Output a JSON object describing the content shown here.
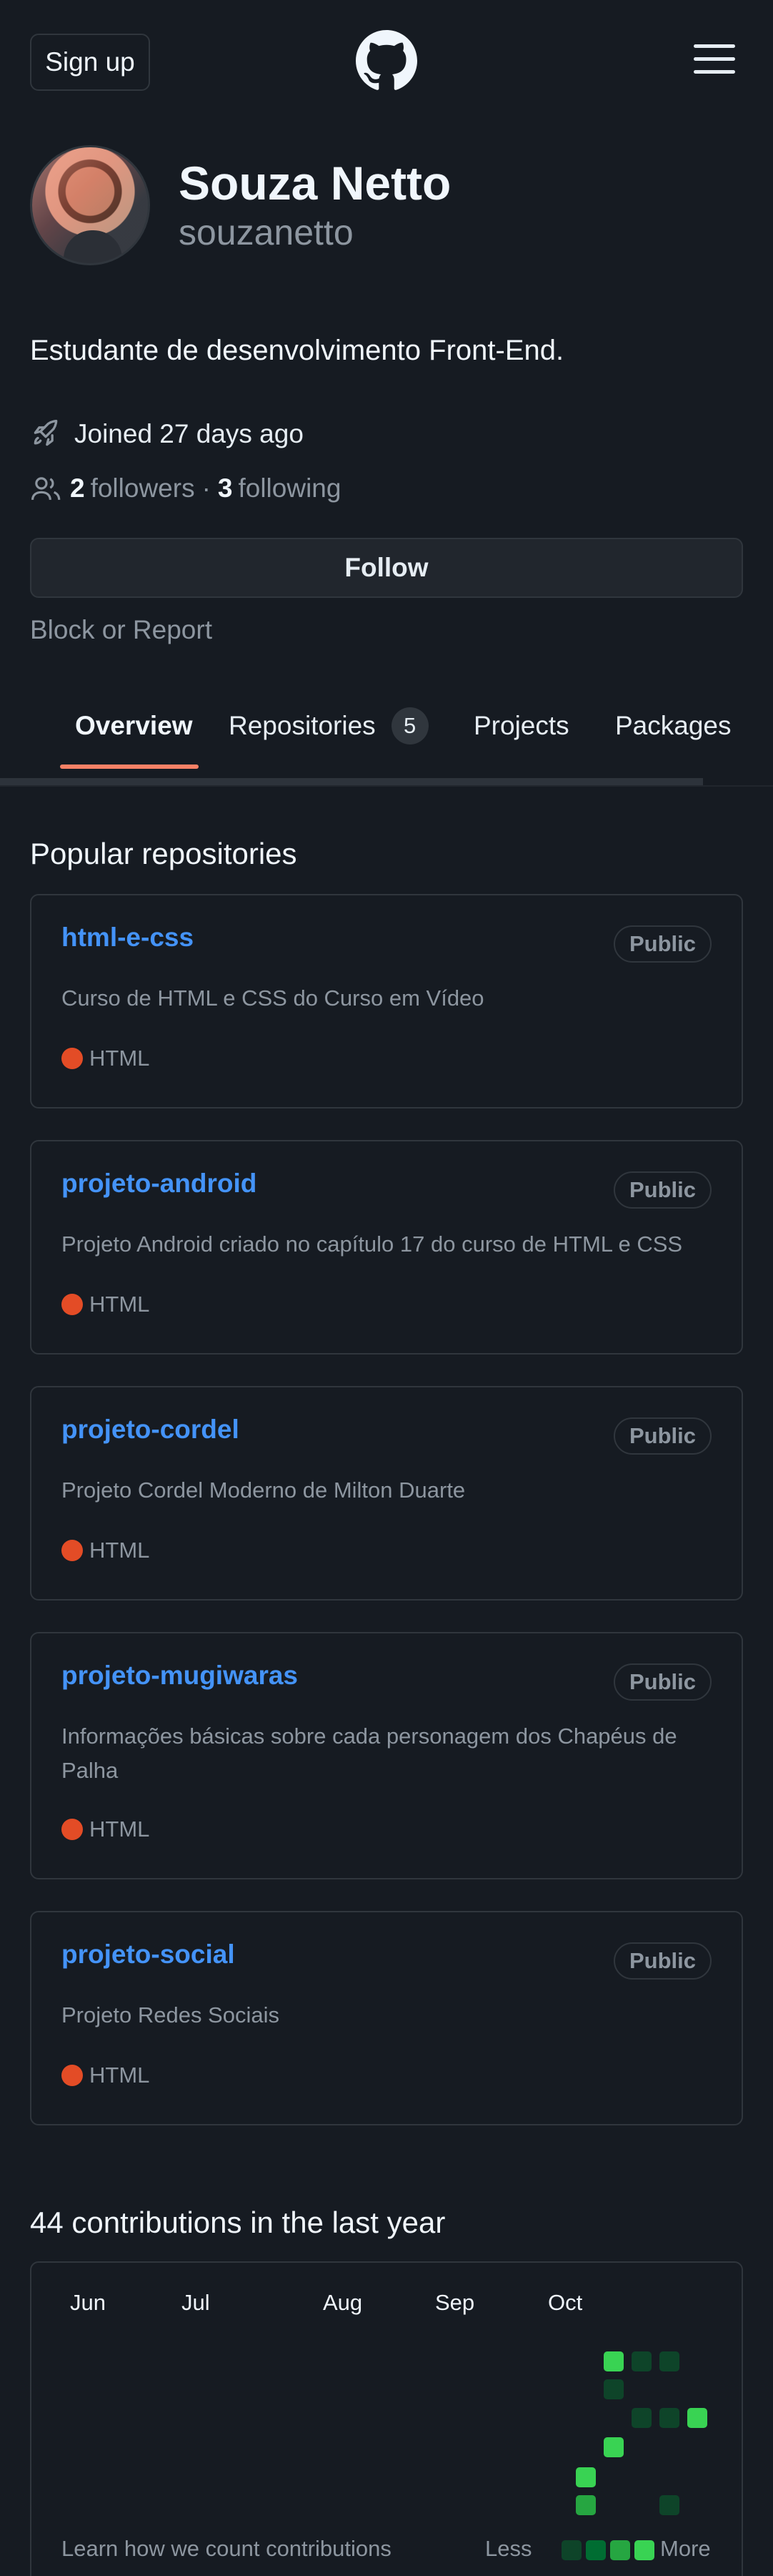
{
  "header": {
    "signup_label": "Sign up",
    "logo_icon": "github-mark-icon",
    "menu_icon": "hamburger-menu-icon"
  },
  "profile": {
    "full_name": "Souza Netto",
    "username": "souzanetto",
    "bio": "Estudante de desenvolvimento Front-End.",
    "joined": "Joined 27 days ago",
    "followers_count": "2",
    "followers_label": "followers",
    "separator": "·",
    "following_count": "3",
    "following_label": "following",
    "follow_label": "Follow",
    "block_report": "Block or Report"
  },
  "tabs": [
    {
      "label": "Overview",
      "active": true
    },
    {
      "label": "Repositories",
      "count": "5"
    },
    {
      "label": "Projects"
    },
    {
      "label": "Packages"
    }
  ],
  "popular": {
    "title": "Popular repositories",
    "repos": [
      {
        "name": "html-e-css",
        "visibility": "Public",
        "description": "Curso de HTML e CSS do Curso em Vídeo",
        "language": "HTML"
      },
      {
        "name": "projeto-android",
        "visibility": "Public",
        "description": "Projeto Android criado no capítulo 17 do curso de HTML e CSS",
        "language": "HTML"
      },
      {
        "name": "projeto-cordel",
        "visibility": "Public",
        "description": "Projeto Cordel Moderno de Milton Duarte",
        "language": "HTML"
      },
      {
        "name": "projeto-mugiwaras",
        "visibility": "Public",
        "description": "Informações básicas sobre cada personagem dos Chapéus de Palha",
        "language": "HTML"
      },
      {
        "name": "projeto-social",
        "visibility": "Public",
        "description": "Projeto Redes Sociais",
        "language": "HTML"
      }
    ]
  },
  "contributions": {
    "title": "44 contributions in the last year",
    "months": [
      "Jun",
      "Jul",
      "Aug",
      "Sep",
      "Oct"
    ],
    "learn_link": "Learn how we count contributions",
    "legend_less": "Less",
    "legend_more": "More"
  },
  "colors": {
    "background": "#161b22",
    "link": "#4493f8",
    "tab_underline": "#f78166",
    "html_language": "#e34c26",
    "contrib_levels": [
      "#0e4429",
      "#006d32",
      "#26a641",
      "#39d353"
    ]
  }
}
